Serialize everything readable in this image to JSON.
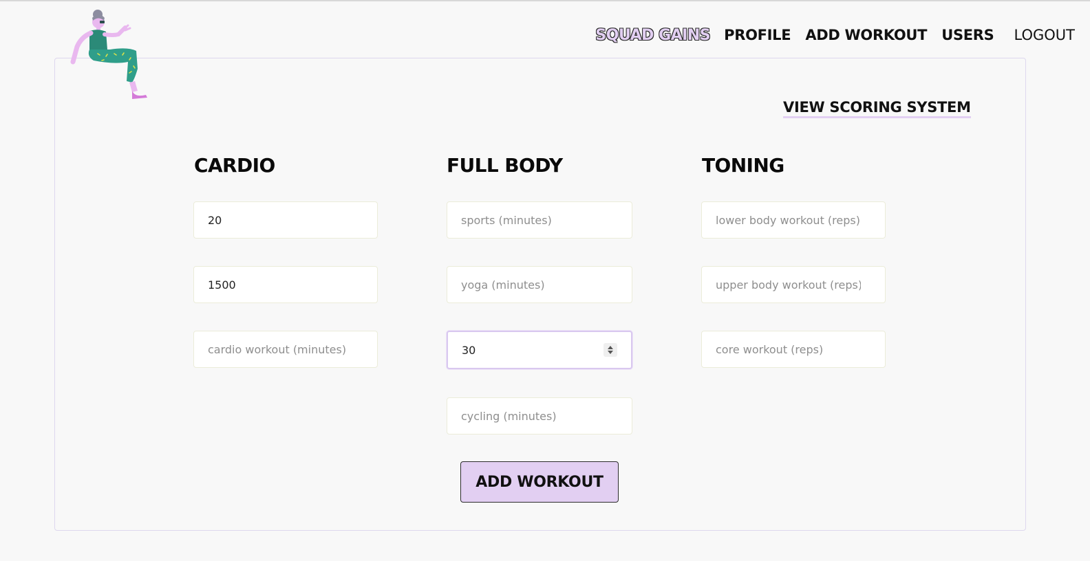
{
  "nav": {
    "brand": "SQUAD GAINS",
    "profile": "PROFILE",
    "add_workout": "ADD WORKOUT",
    "users": "USERS",
    "logout": "LOGOUT"
  },
  "scoring_link": "VIEW SCORING SYSTEM",
  "columns": {
    "cardio": {
      "title": "CARDIO",
      "fields": [
        {
          "value": "20",
          "placeholder": ""
        },
        {
          "value": "1500",
          "placeholder": ""
        },
        {
          "value": "",
          "placeholder": "cardio workout (minutes)"
        }
      ]
    },
    "full_body": {
      "title": "FULL BODY",
      "fields": [
        {
          "value": "",
          "placeholder": "sports (minutes)"
        },
        {
          "value": "",
          "placeholder": "yoga (minutes)"
        },
        {
          "value": "30",
          "placeholder": ""
        },
        {
          "value": "",
          "placeholder": "cycling (minutes)"
        }
      ]
    },
    "toning": {
      "title": "TONING",
      "fields": [
        {
          "value": "",
          "placeholder": "lower body workout (reps)"
        },
        {
          "value": "",
          "placeholder": "upper body workout (reps)"
        },
        {
          "value": "",
          "placeholder": "core workout (reps)"
        }
      ]
    }
  },
  "submit_label": "ADD WORKOUT",
  "colors": {
    "accent": "#e2cff2",
    "background": "#f8f8f8",
    "text": "#111111",
    "field_border": "#ebecd9"
  },
  "icons": {
    "mascot": "sitting-person-illustration",
    "number_spinner": "up-down-spinner-icon"
  }
}
